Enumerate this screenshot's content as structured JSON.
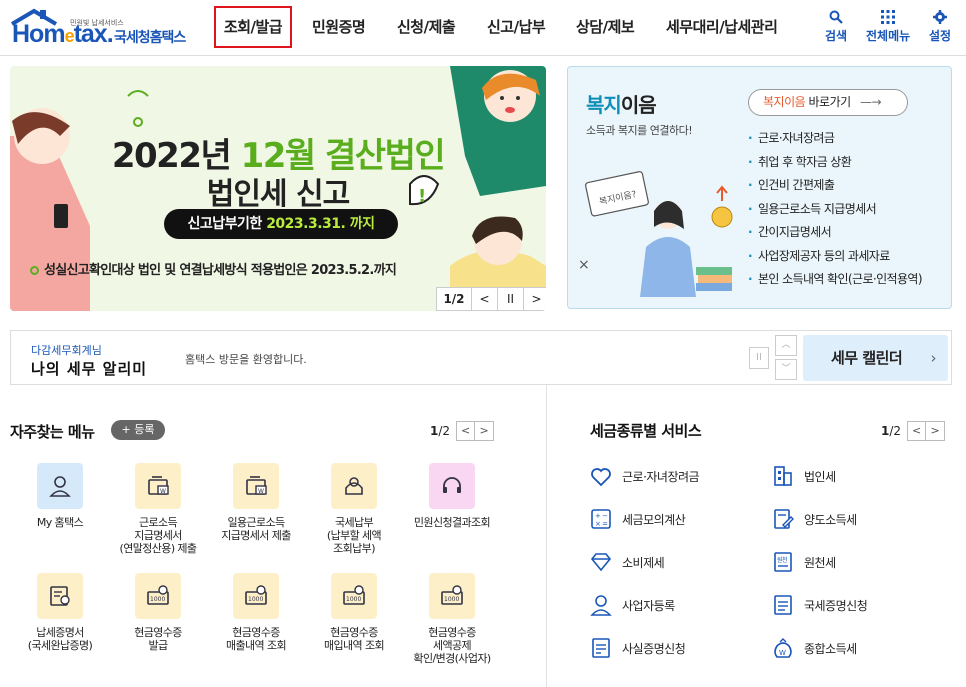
{
  "header": {
    "logo_small": "민원빛 납세서비스",
    "logo_main_1": "Hom",
    "logo_main_e": "e",
    "logo_main_2": "tax.",
    "logo_kr": "국세청홈택스",
    "nav": [
      "조회/발급",
      "민원증명",
      "신청/제출",
      "신고/납부",
      "상담/제보",
      "세무대리/납세관리"
    ],
    "active_nav": "조회/발급",
    "tools": {
      "search": "검색",
      "all_menu": "전체메뉴",
      "settings": "설정"
    }
  },
  "banner": {
    "title_a": "2022년 ",
    "title_b": "12월 결산법인",
    "subtitle": "법인세 신고",
    "pill_a": "신고납부기한 ",
    "pill_b": "2023.3.31. 까지",
    "note": "성실신고확인대상 법인 및 연결납세방식 적용법인은 2023.5.2.까지",
    "page": "1/2",
    "prev": "<",
    "pause": "II",
    "next": ">",
    "colors": {
      "accent": "#5aae1e",
      "background": "#f1f7e5"
    }
  },
  "welfare": {
    "title_a": "복지",
    "title_b": "이음",
    "desc": "소득과 복지를 연결하다!",
    "button_a": "복지이음",
    "button_b": " 바로가기",
    "button_arrow": "—→",
    "card_label": "복지이음?",
    "items": [
      "근로·자녀장려금",
      "취업 후 학자금 상환",
      "인건비 간편제출",
      "일용근로소득 지급명세서",
      "간이지급명세서",
      "사업장제공자 등의 과세자료",
      "본인 소득내역 확인(근로·인적용역)"
    ]
  },
  "notice": {
    "name": "다감세무회계님",
    "title": "나의 세무 알리미",
    "message": "홈택스 방문을 환영합니다.",
    "pause": "II",
    "up": "︿",
    "down": "﹀",
    "calendar": "세무 캘린더",
    "calendar_arrow": "›"
  },
  "favorites": {
    "title": "자주찾는 메뉴",
    "add": "+ 등록",
    "page_current": "1",
    "page_total": "/2",
    "prev": "<",
    "next": ">",
    "items": [
      {
        "label": "My 홈택스",
        "icon": "user-icon",
        "color": "#d6e9fb"
      },
      {
        "label": "근로소득\n지급명세서\n(연말정산용) 제출",
        "icon": "document-submit-icon",
        "color": "#fdf0c9"
      },
      {
        "label": "일용근로소득\n지급명세서 제출",
        "icon": "document-submit-icon",
        "color": "#fdf0c9"
      },
      {
        "label": "국세납부\n(납부할 세액\n조회납부)",
        "icon": "payment-icon",
        "color": "#fdf0c9"
      },
      {
        "label": "민원신청결과조회",
        "icon": "headset-icon",
        "color": "#f9d7f2"
      },
      {
        "label": "납세증명서\n(국세완납증명)",
        "icon": "certificate-icon",
        "color": "#fdf0c9"
      },
      {
        "label": "현금영수증\n발급",
        "icon": "receipt-icon",
        "color": "#fdf0c9"
      },
      {
        "label": "현금영수증\n매출내역 조회",
        "icon": "receipt-icon",
        "color": "#fdf0c9"
      },
      {
        "label": "현금영수증\n매입내역 조회",
        "icon": "receipt-icon",
        "color": "#fdf0c9"
      },
      {
        "label": "현금영수증\n세액공제\n확인/변경(사업자)",
        "icon": "receipt-icon",
        "color": "#fdf0c9"
      }
    ]
  },
  "tax_services": {
    "title": "세금종류별 서비스",
    "page_current": "1",
    "page_total": "/2",
    "prev": "<",
    "next": ">",
    "items": [
      {
        "label": "근로·자녀장려금",
        "icon": "heart-icon"
      },
      {
        "label": "법인세",
        "icon": "building-icon"
      },
      {
        "label": "세금모의계산",
        "icon": "calculator-icon"
      },
      {
        "label": "양도소득세",
        "icon": "transfer-document-icon"
      },
      {
        "label": "소비제세",
        "icon": "diamond-icon"
      },
      {
        "label": "원천세",
        "icon": "withholding-icon"
      },
      {
        "label": "사업자등록",
        "icon": "business-user-icon"
      },
      {
        "label": "국세증명신청",
        "icon": "certificate-document-icon"
      },
      {
        "label": "사실증명신청",
        "icon": "fact-document-icon"
      },
      {
        "label": "종합소득세",
        "icon": "money-bag-icon"
      }
    ]
  }
}
